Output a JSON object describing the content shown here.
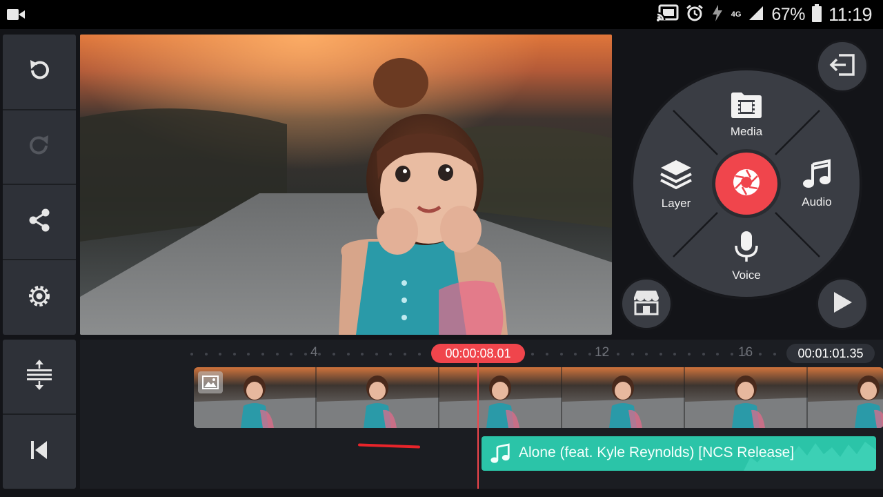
{
  "status_bar": {
    "battery_percent": "67%",
    "time": "11:19",
    "network": "4G",
    "icons": [
      "video-record-icon",
      "cast-icon",
      "alarm-icon",
      "flash-icon",
      "signal-icon",
      "battery-icon"
    ]
  },
  "left_toolbar": {
    "top_icons": [
      "undo-icon",
      "redo-icon",
      "share-icon",
      "settings-icon"
    ],
    "bottom_icons": [
      "timeline-expand-icon",
      "skip-to-start-icon"
    ]
  },
  "preview": {
    "content": "photo"
  },
  "wheel": {
    "media_label": "Media",
    "audio_label": "Audio",
    "voice_label": "Voice",
    "layer_label": "Layer",
    "center_icon": "camera-shutter-icon",
    "accent_color": "#f0454c"
  },
  "right_buttons": {
    "exit_icon": "exit-icon",
    "store_icon": "store-icon",
    "play_icon": "play-icon"
  },
  "timeline": {
    "tick_labels": [
      "4",
      "12",
      "16"
    ],
    "current_time": "00:00:08.01",
    "total_time": "00:01:01.35",
    "audio_clip_title": "Alone (feat. Kyle Reynolds) [NCS Release]",
    "audio_color": "#2bc4a8"
  }
}
